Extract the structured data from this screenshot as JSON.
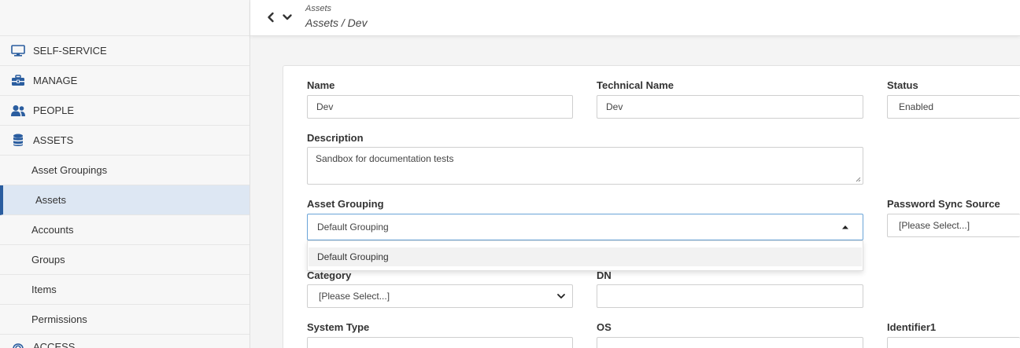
{
  "header": {
    "breadcrumb_small": "Assets",
    "breadcrumb_main": "Assets / Dev"
  },
  "sidebar": {
    "sections": [
      {
        "label": "SELF-SERVICE",
        "icon": "monitor-icon"
      },
      {
        "label": "MANAGE",
        "icon": "toolbox-icon"
      },
      {
        "label": "PEOPLE",
        "icon": "people-icon"
      },
      {
        "label": "ASSETS",
        "icon": "database-icon"
      }
    ],
    "sub_items": [
      "Asset Groupings",
      "Assets",
      "Accounts",
      "Groups",
      "Items",
      "Permissions"
    ],
    "active_sub_item": "Assets",
    "clipped_section": {
      "label": "ACCESS",
      "icon": "fingerprint-icon"
    }
  },
  "form": {
    "name": {
      "label": "Name",
      "value": "Dev"
    },
    "technical_name": {
      "label": "Technical Name",
      "value": "Dev"
    },
    "status": {
      "label": "Status",
      "value": "Enabled"
    },
    "description": {
      "label": "Description",
      "value": "Sandbox for documentation tests"
    },
    "asset_grouping": {
      "label": "Asset Grouping",
      "value": "Default Grouping",
      "options": [
        "Default Grouping"
      ]
    },
    "password_sync_source": {
      "label": "Password Sync Source",
      "value": "[Please Select...]"
    },
    "category": {
      "label": "Category",
      "value": "[Please Select...]"
    },
    "dn": {
      "label": "DN",
      "value": ""
    },
    "system_type": {
      "label": "System Type",
      "value": ""
    },
    "os": {
      "label": "OS",
      "value": ""
    },
    "identifier1": {
      "label": "Identifier1",
      "value": ""
    }
  },
  "colors": {
    "accent": "#2a5d9f",
    "active_bg": "#dde7f3",
    "focus_border": "#6aa4d8"
  }
}
